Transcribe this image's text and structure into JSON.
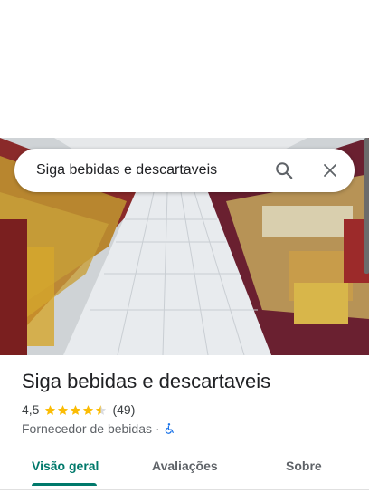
{
  "search": {
    "query": "Siga bebidas e descartaveis"
  },
  "place": {
    "name": "Siga bebidas e descartaveis",
    "rating": "4,5",
    "rating_value": 4.5,
    "reviews_count": "(49)",
    "category": "Fornecedor de bebidas",
    "separator": "·"
  },
  "icons": {
    "search": "search-icon",
    "close": "close-icon",
    "accessibility": "wheelchair-icon",
    "star": "star-icon"
  },
  "tabs": [
    {
      "label": "Visão geral",
      "active": true
    },
    {
      "label": "Avaliações",
      "active": false
    },
    {
      "label": "Sobre",
      "active": false
    }
  ],
  "colors": {
    "accent": "#00796b",
    "star": "#fbbc04",
    "accessibility_blue": "#1a73e8"
  }
}
